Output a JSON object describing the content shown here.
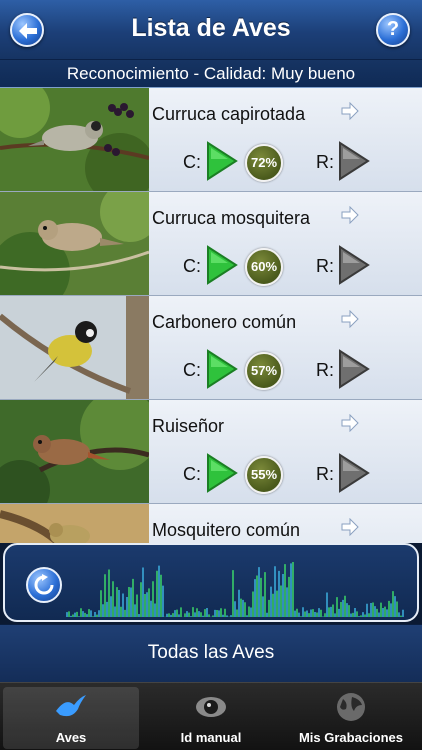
{
  "nav": {
    "title": "Lista de Aves",
    "help_label": "?"
  },
  "status": {
    "text": "Reconocimiento - Calidad: Muy bueno"
  },
  "labels": {
    "c": "C:",
    "r": "R:"
  },
  "birds": [
    {
      "name": "Curruca capirotada",
      "percent": "72%"
    },
    {
      "name": "Curruca mosquitera",
      "percent": "60%"
    },
    {
      "name": "Carbonero común",
      "percent": "57%"
    },
    {
      "name": "Ruiseñor",
      "percent": "55%"
    },
    {
      "name": "Mosquitero común",
      "percent": ""
    }
  ],
  "bottom_button": {
    "label": "Todas las Aves"
  },
  "tabs": [
    {
      "label": "Aves",
      "icon": "bird-icon",
      "selected": true
    },
    {
      "label": "Id manual",
      "icon": "eye-icon",
      "selected": false
    },
    {
      "label": "Mis Grabaciones",
      "icon": "globe-icon",
      "selected": false
    }
  ],
  "colors": {
    "nav_blue": "#1c3f78",
    "play_green": "#2fc23c",
    "badge_olive": "#4a5a1c",
    "wave_green": "#3ee26a",
    "wave_cyan": "#3fb8e8"
  }
}
